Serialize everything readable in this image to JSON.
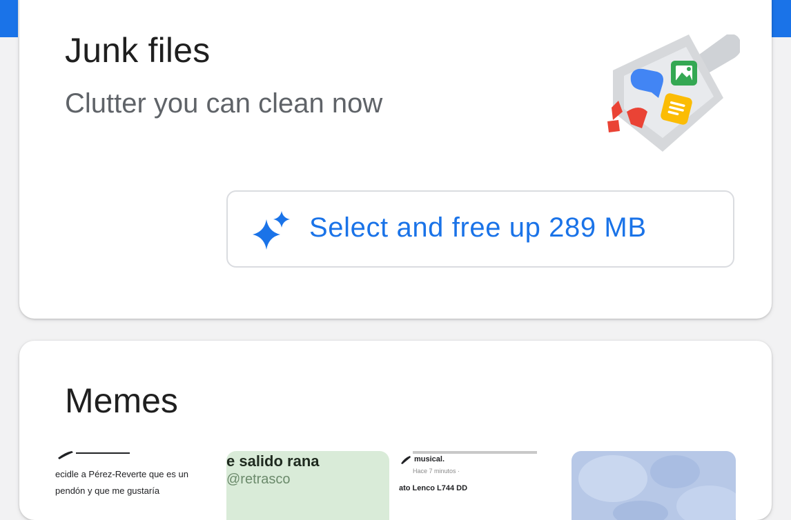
{
  "junk_card": {
    "title": "Junk files",
    "subtitle": "Clutter you can clean now",
    "action_label": "Select and free up 289 MB",
    "icons": {
      "action": "sparkle-icon",
      "illustration": "dustpan-illustration"
    }
  },
  "memes_card": {
    "title": "Memes",
    "thumbnails": [
      {
        "lines": [
          "ecidle a Pérez-Reverte que es un",
          "pendón y que me gustaría"
        ]
      },
      {
        "lines": [
          "e salido rana",
          "@retrasco"
        ]
      },
      {
        "lines": [
          "musical.",
          "Hace 7 minutos ·",
          "ato Lenco L744 DD"
        ]
      },
      {
        "lines": []
      }
    ]
  },
  "colors": {
    "accent": "#1a73e8",
    "card_background": "#ffffff",
    "page_background": "#f2f2f3",
    "title_text": "#1f1f1f",
    "subtitle_text": "#5f6368",
    "button_border": "#dadce0"
  }
}
